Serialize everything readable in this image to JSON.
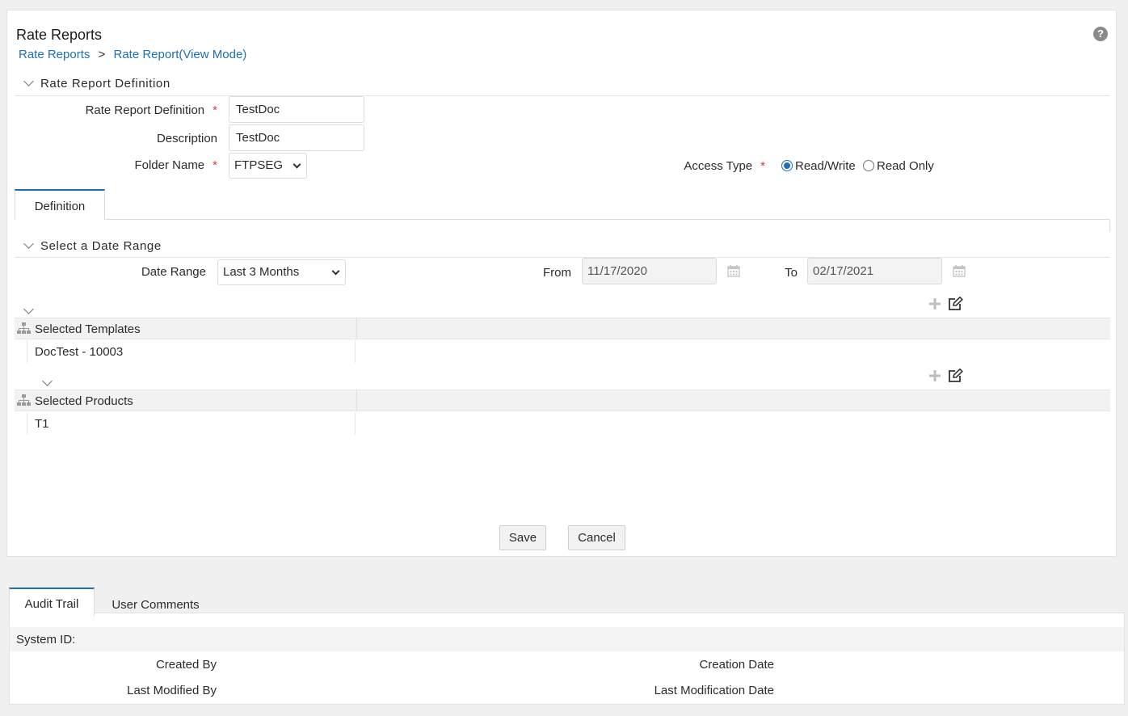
{
  "header": {
    "title": "Rate Reports",
    "help_icon": "?",
    "breadcrumb": {
      "root": "Rate Reports",
      "separator": ">",
      "current": "Rate Report(View Mode)"
    }
  },
  "definition_section": {
    "title": "Rate Report Definition",
    "fields": {
      "name_label": "Rate Report Definition",
      "name_value": "TestDoc",
      "description_label": "Description",
      "description_value": "TestDoc",
      "folder_label": "Folder Name",
      "folder_value": "FTPSEG",
      "access_label": "Access Type",
      "access_options": [
        "Read/Write",
        "Read Only"
      ],
      "access_selected": "Read/Write",
      "required_marker": "*"
    }
  },
  "tabs": {
    "definition": "Definition"
  },
  "date_section": {
    "title": "Select a Date Range",
    "range_label": "Date Range",
    "range_value": "Last 3 Months",
    "from_label": "From",
    "from_value": "11/17/2020",
    "to_label": "To",
    "to_value": "02/17/2021"
  },
  "templates_grid": {
    "header": "Selected Templates",
    "rows": [
      "DocTest - 10003"
    ]
  },
  "products_grid": {
    "header": "Selected Products",
    "rows": [
      "T1"
    ]
  },
  "actions": {
    "save": "Save",
    "cancel": "Cancel"
  },
  "bottom_tabs": {
    "audit": "Audit Trail",
    "comments": "User Comments"
  },
  "audit": {
    "system_id_label": "System ID:",
    "created_by_label": "Created By",
    "creation_date_label": "Creation Date",
    "last_modified_by_label": "Last Modified By",
    "last_modification_date_label": "Last Modification Date"
  },
  "colors": {
    "accent": "#1d6fb8",
    "required": "#d63b3b"
  }
}
